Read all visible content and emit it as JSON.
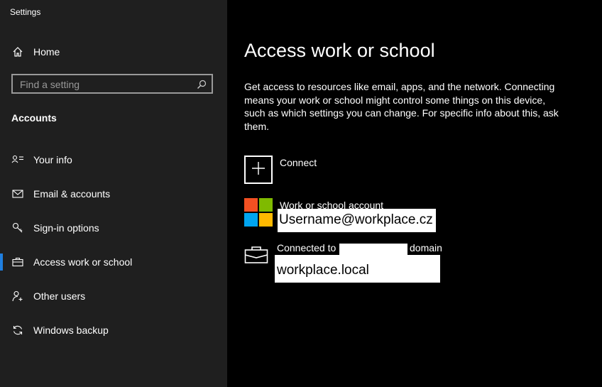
{
  "window": {
    "title": "Settings"
  },
  "sidebar": {
    "home_label": "Home",
    "search": {
      "placeholder": "Find a setting",
      "value": ""
    },
    "section_title": "Accounts",
    "items": [
      {
        "label": "Your info",
        "icon": "person-card-icon"
      },
      {
        "label": "Email & accounts",
        "icon": "envelope-icon"
      },
      {
        "label": "Sign-in options",
        "icon": "key-icon"
      },
      {
        "label": "Access work or school",
        "icon": "briefcase-icon",
        "active": true
      },
      {
        "label": "Other users",
        "icon": "person-add-icon"
      },
      {
        "label": "Windows backup",
        "icon": "sync-icon"
      }
    ]
  },
  "main": {
    "title": "Access work or school",
    "description": "Get access to resources like email, apps, and the network. Connecting means your work or school might control some things on this device, such as which settings you can change. For specific info about this, ask them.",
    "connect_label": "Connect",
    "account": {
      "type_label": "Work or school account",
      "username": "Username@workplace.cz"
    },
    "domain": {
      "prefix": "Connected to",
      "suffix": "domain",
      "value": "workplace.local"
    }
  },
  "colors": {
    "sidebar_bg": "#1f1f1f",
    "main_bg": "#000000",
    "accent": "#1f7fe0",
    "ms_red": "#f25022",
    "ms_green": "#7fba00",
    "ms_blue": "#00a4ef",
    "ms_yellow": "#ffb900"
  }
}
